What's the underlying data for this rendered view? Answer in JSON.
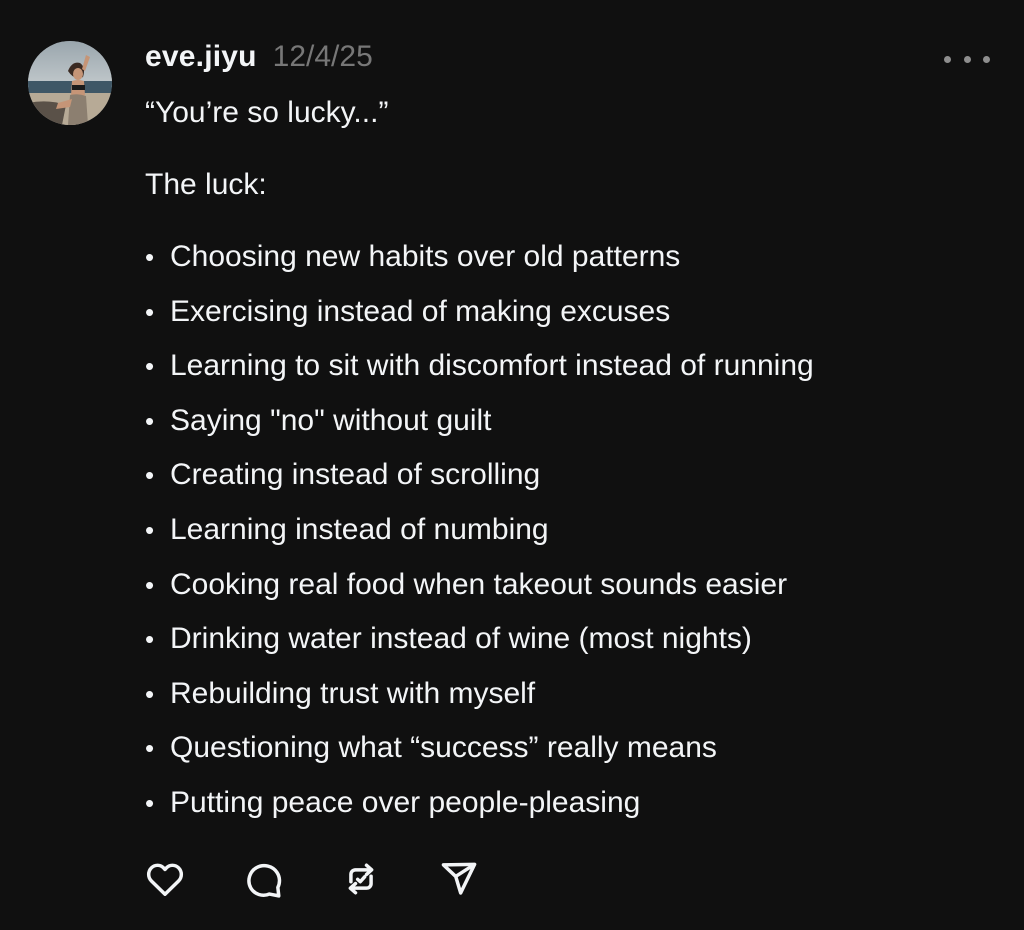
{
  "post": {
    "username": "eve.jiyu",
    "timestamp": "12/4/25",
    "quote": "“You’re so lucky...”",
    "intro": "The luck:",
    "bullet_char": "•",
    "items": [
      "Choosing new habits over old patterns",
      "Exercising instead of making excuses",
      "Learning to sit with discomfort instead of running",
      "Saying \"no\" without guilt",
      "Creating instead of scrolling",
      "Learning instead of numbing",
      "Cooking real food when takeout sounds easier",
      "Drinking water instead of wine (most nights)",
      "Rebuilding trust with myself",
      "Questioning what “success” really means",
      "Putting peace over people-pleasing"
    ]
  },
  "actions": [
    {
      "name": "like",
      "icon": "heart-icon"
    },
    {
      "name": "reply",
      "icon": "comment-icon"
    },
    {
      "name": "repost",
      "icon": "repost-icon"
    },
    {
      "name": "share",
      "icon": "send-icon"
    }
  ],
  "colors": {
    "background": "#101010",
    "text_primary": "#f3f5f7",
    "text_secondary": "#777777",
    "icon": "#f3f5f7"
  }
}
